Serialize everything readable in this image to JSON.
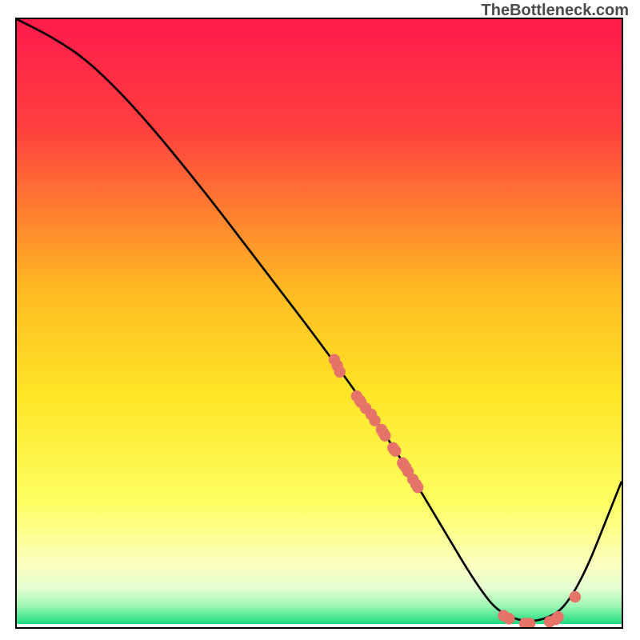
{
  "watermark": "TheBottleneck.com",
  "colors": {
    "border": "#000000",
    "dot": "#e57368",
    "curve": "#000000",
    "gradient_stops": [
      {
        "pct": 0,
        "color": "#ff1a4b"
      },
      {
        "pct": 18,
        "color": "#ff3f3f"
      },
      {
        "pct": 45,
        "color": "#ffbb22"
      },
      {
        "pct": 62,
        "color": "#ffe526"
      },
      {
        "pct": 80,
        "color": "#feff62"
      },
      {
        "pct": 90,
        "color": "#fbffbd"
      },
      {
        "pct": 94,
        "color": "#e7ffd2"
      },
      {
        "pct": 97,
        "color": "#9cf7b2"
      },
      {
        "pct": 100,
        "color": "#1dd97e"
      }
    ]
  },
  "chart_data": {
    "type": "line",
    "title": "",
    "xlabel": "",
    "ylabel": "",
    "xlim": [
      0,
      100
    ],
    "ylim": [
      0,
      100
    ],
    "series": [
      {
        "name": "curve",
        "x": [
          0,
          6,
          12,
          20,
          30,
          40,
          50,
          58,
          64,
          70,
          76,
          80,
          86,
          92,
          100
        ],
        "y": [
          100,
          97,
          93,
          85,
          73,
          60,
          47,
          36,
          27,
          17,
          7,
          2,
          0.5,
          4,
          24
        ]
      }
    ],
    "scatter": [
      {
        "x": 52.5,
        "y": 44
      },
      {
        "x": 53.0,
        "y": 43
      },
      {
        "x": 53.4,
        "y": 42
      },
      {
        "x": 56.2,
        "y": 38
      },
      {
        "x": 56.7,
        "y": 37.3
      },
      {
        "x": 56.9,
        "y": 37
      },
      {
        "x": 57.7,
        "y": 36
      },
      {
        "x": 58.6,
        "y": 35
      },
      {
        "x": 59.2,
        "y": 34
      },
      {
        "x": 60.3,
        "y": 32.5
      },
      {
        "x": 60.6,
        "y": 32
      },
      {
        "x": 60.9,
        "y": 31.5
      },
      {
        "x": 62.2,
        "y": 29.5
      },
      {
        "x": 62.4,
        "y": 29.2
      },
      {
        "x": 62.6,
        "y": 29
      },
      {
        "x": 63.8,
        "y": 27
      },
      {
        "x": 64.0,
        "y": 26.7
      },
      {
        "x": 64.3,
        "y": 26.3
      },
      {
        "x": 64.7,
        "y": 25.6
      },
      {
        "x": 65.5,
        "y": 24.3
      },
      {
        "x": 66.0,
        "y": 23.5
      },
      {
        "x": 66.3,
        "y": 23
      },
      {
        "x": 80.5,
        "y": 1.9
      },
      {
        "x": 81.4,
        "y": 1.4
      },
      {
        "x": 84.0,
        "y": 0.6
      },
      {
        "x": 84.8,
        "y": 0.6
      },
      {
        "x": 88.1,
        "y": 0.9
      },
      {
        "x": 89.1,
        "y": 1.3
      },
      {
        "x": 89.5,
        "y": 1.7
      },
      {
        "x": 92.3,
        "y": 5.0
      }
    ]
  }
}
